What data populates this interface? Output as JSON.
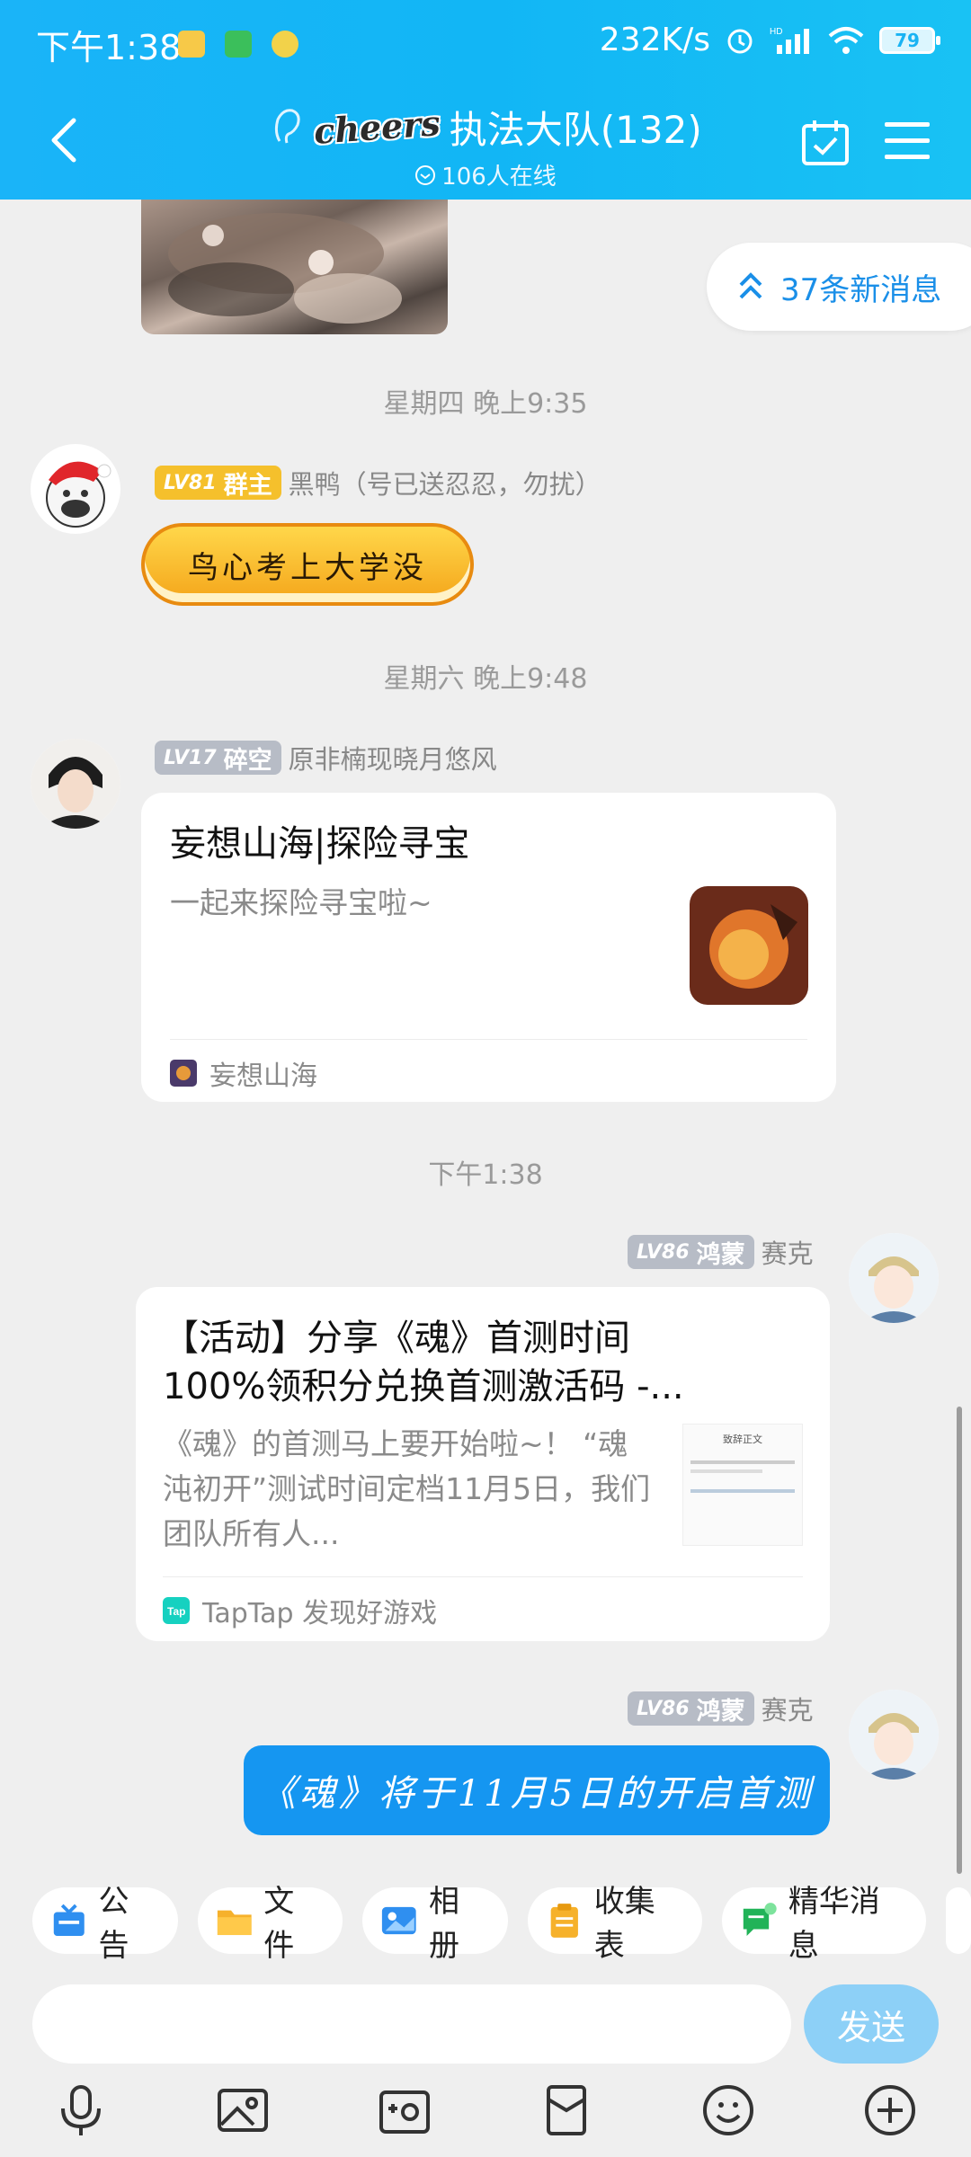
{
  "status_bar": {
    "time": "下午1:38",
    "net_speed": "232K/s",
    "battery": "79"
  },
  "header": {
    "title": "执法大队(132)",
    "logo_text": "cheers",
    "online": "106人在线"
  },
  "new_messages": "37条新消息",
  "chat": {
    "ts1": "星期四 晚上9:35",
    "msg1": {
      "level": "LV81",
      "role": "群主",
      "sender": "黑鸭（号已送忍忍，勿扰）",
      "sticker_text": "鸟心考上大学没"
    },
    "ts2": "星期六 晚上9:48",
    "msg2": {
      "level": "LV17",
      "role": "碎空",
      "sender": "原非楠现晓月悠风",
      "card_title": "妄想山海|探险寻宝",
      "card_desc": "一起来探险寻宝啦~",
      "card_source": "妄想山海"
    },
    "ts3": "下午1:38",
    "msg3": {
      "level": "LV86",
      "role": "鸿蒙",
      "sender": "赛克",
      "card_title_1": "【活动】分享《魂》首测时间",
      "card_title_2": "100%领积分兑换首测激活码 -...",
      "card_desc_1": "《魂》的首测马上要开始啦~！ “魂",
      "card_desc_2": "沌初开”测试时间定档11月5日，我们",
      "card_desc_3": "团队所有人...",
      "card_source": "TapTap 发现好游戏",
      "thumb_title": "致辞正文"
    },
    "msg4": {
      "level": "LV86",
      "role": "鸿蒙",
      "sender": "赛克",
      "text": "《魂》将于11月5日的开启首测"
    }
  },
  "shortcuts": [
    {
      "label": "公告",
      "icon": "announcement-icon"
    },
    {
      "label": "文件",
      "icon": "folder-icon"
    },
    {
      "label": "相册",
      "icon": "album-icon"
    },
    {
      "label": "收集表",
      "icon": "form-icon"
    },
    {
      "label": "精华消息",
      "icon": "essence-icon"
    }
  ],
  "composer": {
    "placeholder": "",
    "send_label": "发送"
  },
  "colors": {
    "header_blue": "#1ab4f8",
    "accent": "#1596f1",
    "send_disabled": "#8dd0f7"
  }
}
